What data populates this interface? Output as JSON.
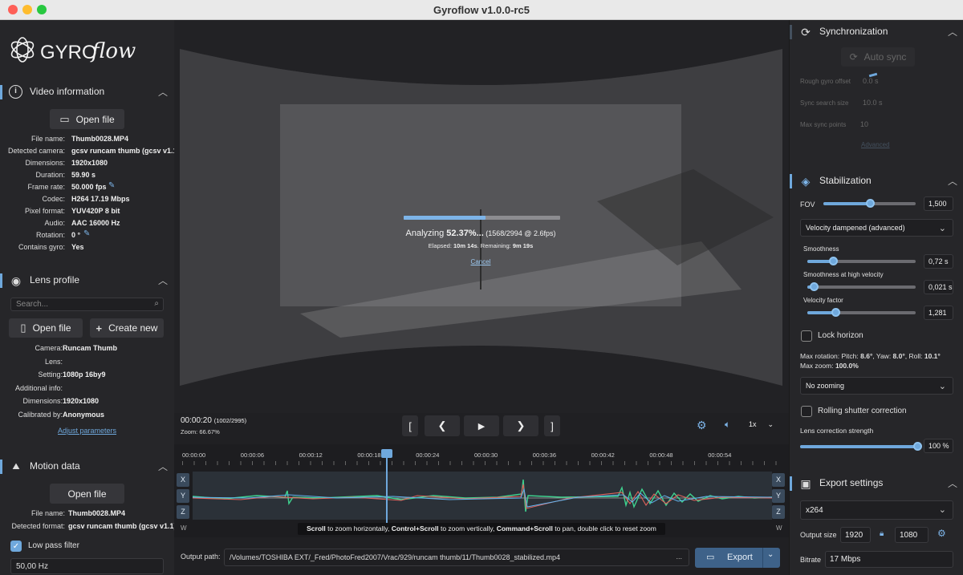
{
  "window": {
    "title": "Gyroflow v1.0.0-rc5"
  },
  "brand": {
    "logo_text": "GYROflow"
  },
  "video_info": {
    "title": "Video information",
    "open_file": "Open file",
    "rows": [
      {
        "k": "File name:",
        "v": "Thumb0028.MP4"
      },
      {
        "k": "Detected camera:",
        "v": "gcsv runcam thumb (gcsv v1.1"
      },
      {
        "k": "Dimensions:",
        "v": "1920x1080"
      },
      {
        "k": "Duration:",
        "v": "59.90 s"
      },
      {
        "k": "Frame rate:",
        "v": "50.000 fps"
      },
      {
        "k": "Codec:",
        "v": "H264 17.19 Mbps"
      },
      {
        "k": "Pixel format:",
        "v": "YUV420P 8 bit"
      },
      {
        "k": "Audio:",
        "v": "AAC 16000 Hz"
      },
      {
        "k": "Rotation:",
        "v": "0 °"
      },
      {
        "k": "Contains gyro:",
        "v": "Yes"
      }
    ]
  },
  "lens_profile": {
    "title": "Lens profile",
    "search_placeholder": "Search...",
    "open_file": "Open file",
    "create_new": "Create new",
    "rows": [
      {
        "k": "Camera:",
        "v": "Runcam Thumb"
      },
      {
        "k": "Lens:",
        "v": ""
      },
      {
        "k": "Setting:",
        "v": "1080p 16by9"
      },
      {
        "k": "Additional info:",
        "v": ""
      },
      {
        "k": "Dimensions:",
        "v": "1920x1080"
      },
      {
        "k": "Calibrated by:",
        "v": "Anonymous"
      }
    ],
    "adjust": "Adjust parameters"
  },
  "motion_data": {
    "title": "Motion data",
    "open_file": "Open file",
    "rows": [
      {
        "k": "File name:",
        "v": "Thumb0028.MP4"
      },
      {
        "k": "Detected format:",
        "v": "gcsv runcam thumb (gcsv v1.1)"
      }
    ],
    "low_pass": "Low pass filter",
    "low_pass_value": "50,00 Hz"
  },
  "analysis": {
    "progress": 0.5237,
    "label_pre": "Analyzing ",
    "percent": "52.37%...",
    "detail": " (1568/2994 @ 2.6fps)",
    "elapsed_pre": "Elapsed: ",
    "elapsed": "10m 14s",
    "remaining_pre": ". Remaining: ",
    "remaining": "9m 19s",
    "cancel": "Cancel"
  },
  "playback": {
    "time": "00:00:20",
    "frame": "(1002/2995)",
    "zoom": "Zoom: 66.67%",
    "speed": "1x"
  },
  "timeline": {
    "ticks": [
      "00:00:00",
      "00:00:06",
      "00:00:12",
      "00:00:18",
      "00:00:24",
      "00:00:30",
      "00:00:36",
      "00:00:42",
      "00:00:48",
      "00:00:54"
    ],
    "playhead": 0.334,
    "axes": [
      "X",
      "Y",
      "Z"
    ],
    "w": "W",
    "hint_1b": "Scroll",
    "hint_2": " to zoom horizontally, ",
    "hint_3b": "Control+Scroll",
    "hint_4": " to zoom vertically, ",
    "hint_5b": "Command+Scroll",
    "hint_6": " to pan, double click to reset zoom"
  },
  "output": {
    "label": "Output path:",
    "path": "/Volumes/TOSHIBA EXT/_Fred/PhotoFred2007/Vrac/929/runcam thumb/11/Thumb0028_stabilized.mp4",
    "more": "...",
    "export": "Export"
  },
  "sync": {
    "title": "Synchronization",
    "auto_sync": "Auto sync",
    "rough_offset_label": "Rough gyro offset",
    "rough_offset": "0.0 s",
    "search_size_label": "Sync search size",
    "search_size": "10.0 s",
    "max_points_label": "Max sync points",
    "max_points": "10",
    "advanced": "Advanced"
  },
  "stabilization": {
    "title": "Stabilization",
    "fov_label": "FOV",
    "fov": "1,500",
    "fov_level": 0.5,
    "method": "Velocity dampened (advanced)",
    "smoothness_label": "Smoothness",
    "smoothness": "0,72 s",
    "smoothness_level": 0.24,
    "smooth_hv_label": "Smoothness at high velocity",
    "smooth_hv": "0,021 s",
    "smooth_hv_level": 0.06,
    "vel_factor_label": "Velocity factor",
    "vel_factor": "1,281",
    "vel_factor_level": 0.26,
    "lock_horizon": "Lock horizon",
    "max_rot_pre": "Max rotation: Pitch: ",
    "pitch": "8.6°",
    "yaw_pre": ", Yaw: ",
    "yaw": "8.0°",
    "roll_pre": ", Roll: ",
    "roll": "10.1°",
    "max_zoom_pre": "Max zoom: ",
    "max_zoom": "100.0%",
    "zooming": "No zooming",
    "rolling_shutter": "Rolling shutter correction",
    "lens_corr_label": "Lens correction strength",
    "lens_corr": "100 %",
    "lens_corr_level": 1.0
  },
  "export_settings": {
    "title": "Export settings",
    "codec": "x264",
    "size_label": "Output size",
    "width": "1920",
    "height": "1080",
    "bitrate_label": "Bitrate",
    "bitrate": "17 Mbps"
  },
  "colors": {
    "accent": "#6fa8dc",
    "panel": "#262629",
    "center": "#202023"
  }
}
